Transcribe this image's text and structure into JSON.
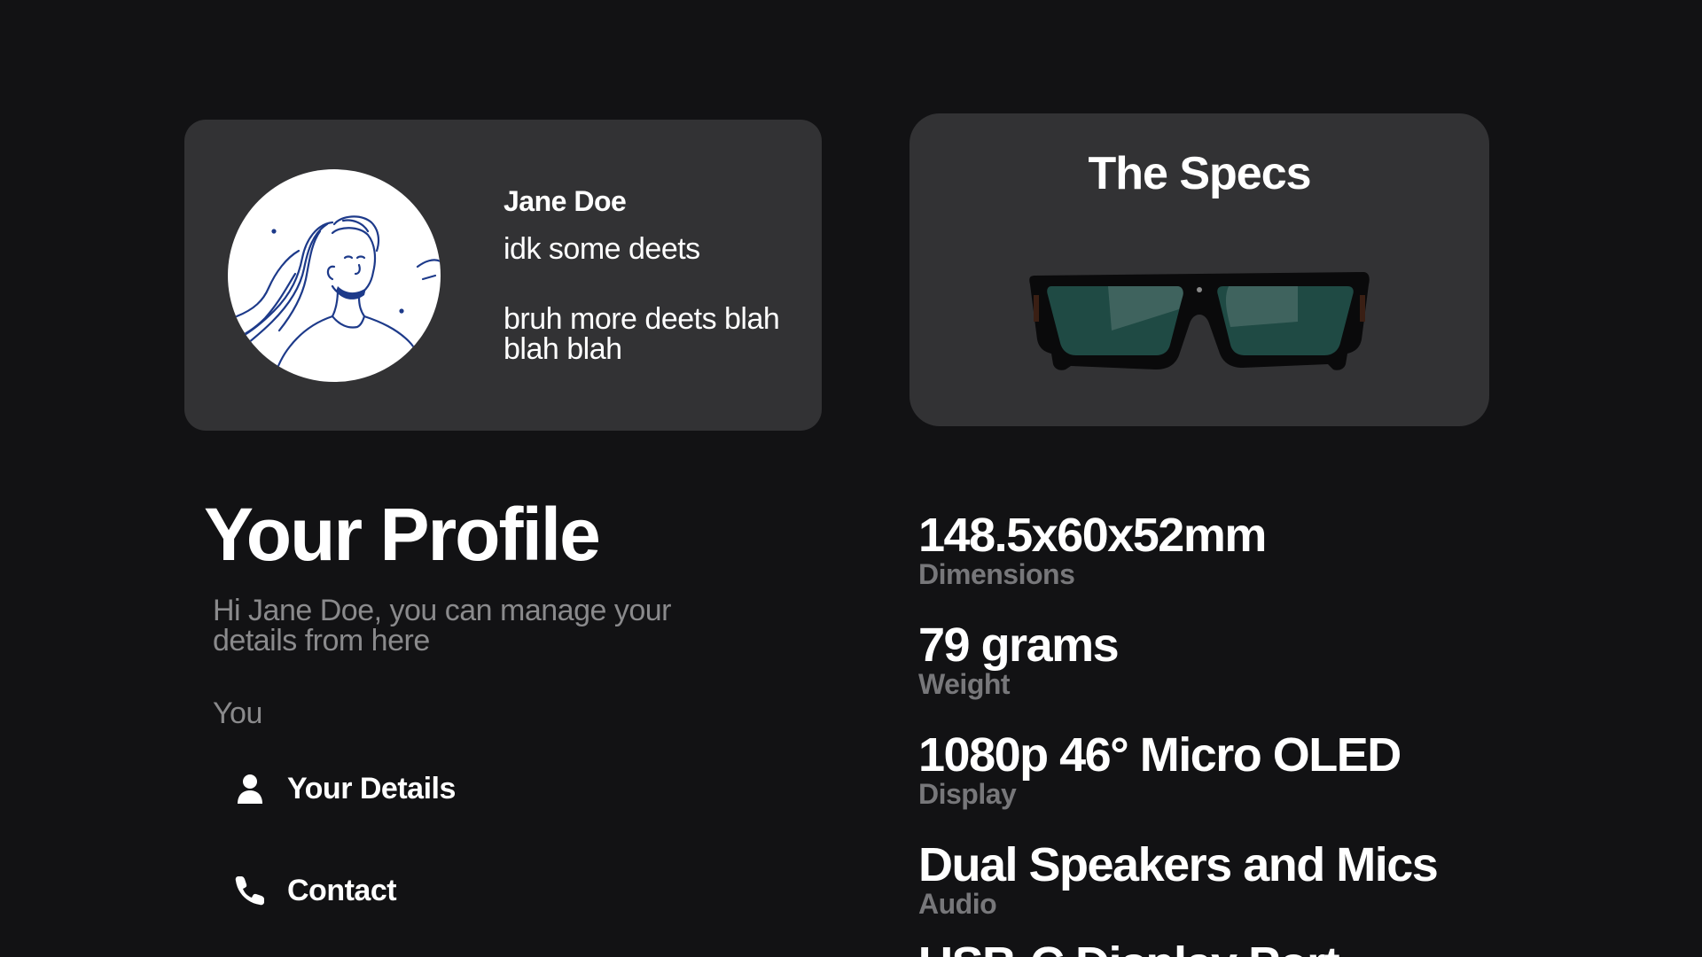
{
  "profile_card": {
    "name": "Jane Doe",
    "line1": "idk some deets",
    "line2": "bruh more deets blah blah blah"
  },
  "specs_card": {
    "title": "The Specs"
  },
  "profile_section": {
    "heading": "Your Profile",
    "subtitle": "Hi Jane Doe, you can manage your details from here",
    "group_label": "You",
    "items": [
      {
        "label": "Your Details",
        "icon": "person-icon"
      },
      {
        "label": "Contact",
        "icon": "phone-icon"
      }
    ]
  },
  "specs": [
    {
      "value": "148.5x60x52mm",
      "label": "Dimensions"
    },
    {
      "value": "79 grams",
      "label": "Weight"
    },
    {
      "value": "1080p 46° Micro OLED",
      "label": "Display"
    },
    {
      "value": "Dual Speakers and Mics",
      "label": "Audio"
    },
    {
      "value": "USB-C Display Port",
      "label": ""
    }
  ],
  "colors": {
    "background": "#121214",
    "card": "#323234",
    "muted_text": "#8a8a8c",
    "spec_label": "#77777a",
    "avatar_line": "#1d3a8a"
  }
}
